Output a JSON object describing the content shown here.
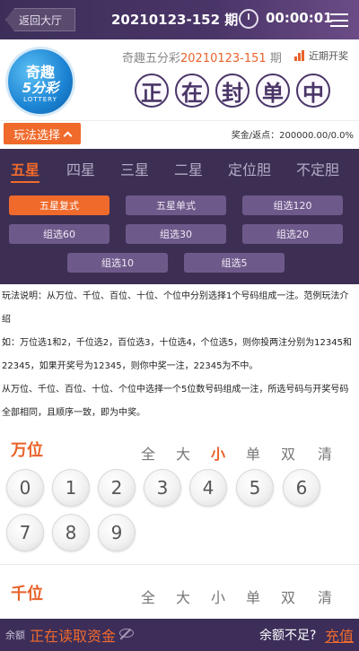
{
  "topbar": {
    "back_label": "返回大厅",
    "issue": "20210123-152 期",
    "timer": "00:00:01"
  },
  "header": {
    "logo": {
      "top": "奇趣",
      "mid": "5分彩",
      "bottom": "LOTTERY"
    },
    "prev_prefix": "奇趣五分彩",
    "prev_issue": "20210123-151",
    "prev_suffix": "期",
    "history_label": "近期开奖",
    "status_chars": [
      "正",
      "在",
      "封",
      "单",
      "中"
    ]
  },
  "play": {
    "select_label": "玩法选择",
    "prize_text": "奖金/返点：200000.00/0.0%"
  },
  "categories": [
    "五星",
    "四星",
    "三星",
    "二星",
    "定位胆",
    "不定胆"
  ],
  "sub_options": [
    "五星复式",
    "五星单式",
    "组选120",
    "组选60",
    "组选30",
    "组选20",
    "组选10",
    "组选5"
  ],
  "description": [
    "玩法说明：从万位、千位、百位、十位、个位中分别选择1个号码组成一注。范例玩法介绍",
    "如：万位选1和2，千位选2，百位选3，十位选4，个位选5，则你投两注分别为12345和22345，如果开奖号为12345，则你中奖一注，22345为不中。",
    "从万位、千位、百位、十位、个位中选择一个5位数号码组成一注，所选号码与开奖号码全部相同，且顺序一致，即为中奖。"
  ],
  "sections": [
    {
      "title": "万位",
      "active_filter": "小"
    },
    {
      "title": "千位",
      "active_filter": ""
    }
  ],
  "filters": [
    "全",
    "大",
    "小",
    "单",
    "双",
    "清"
  ],
  "digits": [
    "0",
    "1",
    "2",
    "3",
    "4",
    "5",
    "6",
    "7",
    "8",
    "9"
  ],
  "footer": {
    "balance_label": "余额",
    "balance_status": "正在读取资金",
    "insufficient": "余额不足?",
    "recharge": "充值"
  },
  "colors": {
    "accent": "#f06a2c",
    "purple": "#3c2f53"
  }
}
